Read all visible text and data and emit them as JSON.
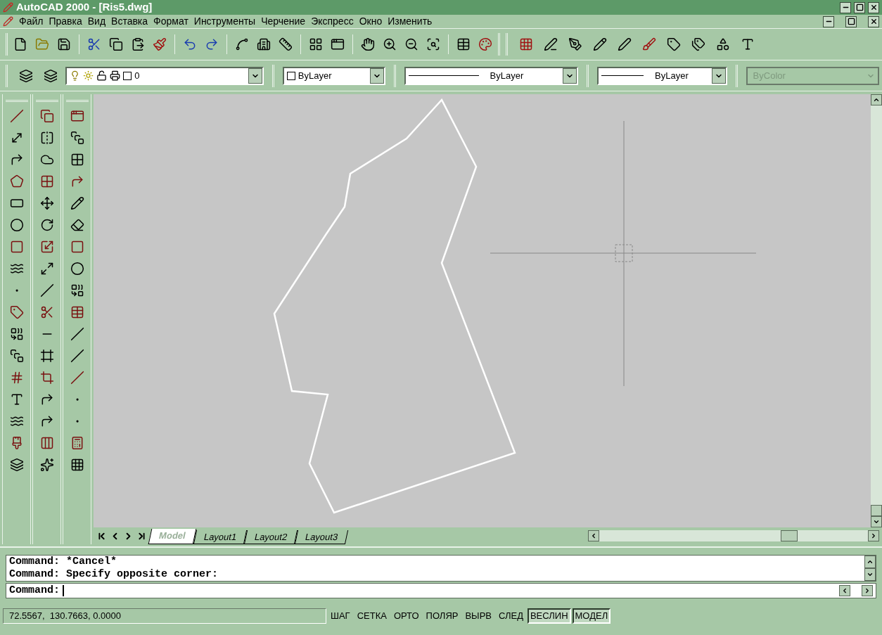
{
  "window": {
    "title": "AutoCAD 2000 - [Ris5.dwg]"
  },
  "menu": [
    "Файл",
    "Правка",
    "Вид",
    "Вставка",
    "Формат",
    "Инструменты",
    "Черчение",
    "Экспресс",
    "Окно",
    "Изменить"
  ],
  "properties_toolbar": {
    "layer": "0",
    "color_setting": "ByLayer",
    "linetype": "ByLayer",
    "lineweight": "ByLayer",
    "plot_style": {
      "value": "ByColor",
      "disabled": true
    }
  },
  "layout_tabs": [
    {
      "label": "Model",
      "selected": true
    },
    {
      "label": "Layout1",
      "selected": false
    },
    {
      "label": "Layout2",
      "selected": false
    },
    {
      "label": "Layout3",
      "selected": false
    }
  ],
  "command_history": [
    "Command: *Cancel*",
    "Command: Specify opposite corner:"
  ],
  "command_prompt": "Command:",
  "status_bar": {
    "coordinates": "72.5567,  130.7663, 0.0000",
    "modes": [
      {
        "label": "ШАГ",
        "on": false
      },
      {
        "label": "СЕТКА",
        "on": false
      },
      {
        "label": "ОРТО",
        "on": false
      },
      {
        "label": "ПОЛЯР",
        "on": false
      },
      {
        "label": "ВЫРВ",
        "on": false
      },
      {
        "label": "СЛЕД",
        "on": false
      },
      {
        "label": "ВЕСЛИН",
        "on": true
      },
      {
        "label": "МОДЕЛ",
        "on": true
      }
    ]
  }
}
